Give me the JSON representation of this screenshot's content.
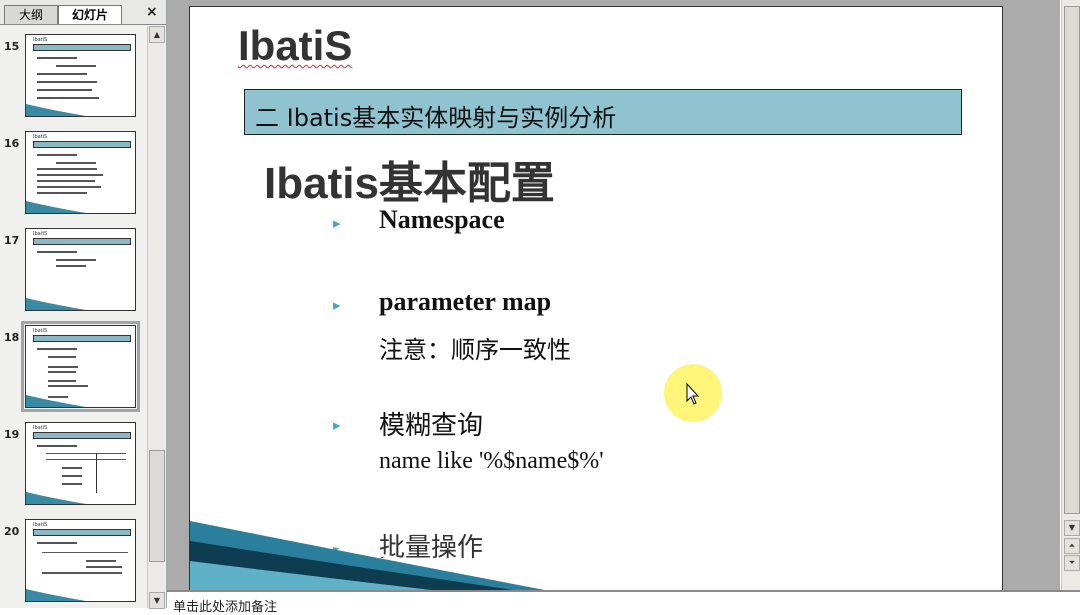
{
  "outline_pane": {
    "tabs": [
      {
        "label": "大纲"
      },
      {
        "label": "幻灯片"
      }
    ],
    "close_glyph": "×",
    "thumbnails": [
      {
        "number": "15",
        "thumb_title": "IbatiS"
      },
      {
        "number": "16",
        "thumb_title": "IbatiS"
      },
      {
        "number": "17",
        "thumb_title": "IbatiS"
      },
      {
        "number": "18",
        "thumb_title": "IbatiS",
        "selected": true
      },
      {
        "number": "19",
        "thumb_title": "IbatiS"
      },
      {
        "number": "20",
        "thumb_title": "IbatiS"
      }
    ]
  },
  "slide": {
    "title": "IbatiS",
    "section": "二 Ibatis基本实体映射与实例分析",
    "heading": "Ibatis基本配置",
    "items": [
      {
        "label": "Namespace",
        "sub": ""
      },
      {
        "label": "parameter map",
        "sub": "注意：顺序一致性"
      },
      {
        "label": "模糊查询",
        "sub": "name like '%$name$%'"
      },
      {
        "label": "批量操作",
        "sub": ""
      }
    ],
    "bullet_glyph": "▸"
  },
  "notes": {
    "placeholder": "单击此处添加备注"
  },
  "colors": {
    "accent": "#4aa6bd",
    "section_bar": "#8fc3cf",
    "cursor_halo": "#fff56a"
  }
}
